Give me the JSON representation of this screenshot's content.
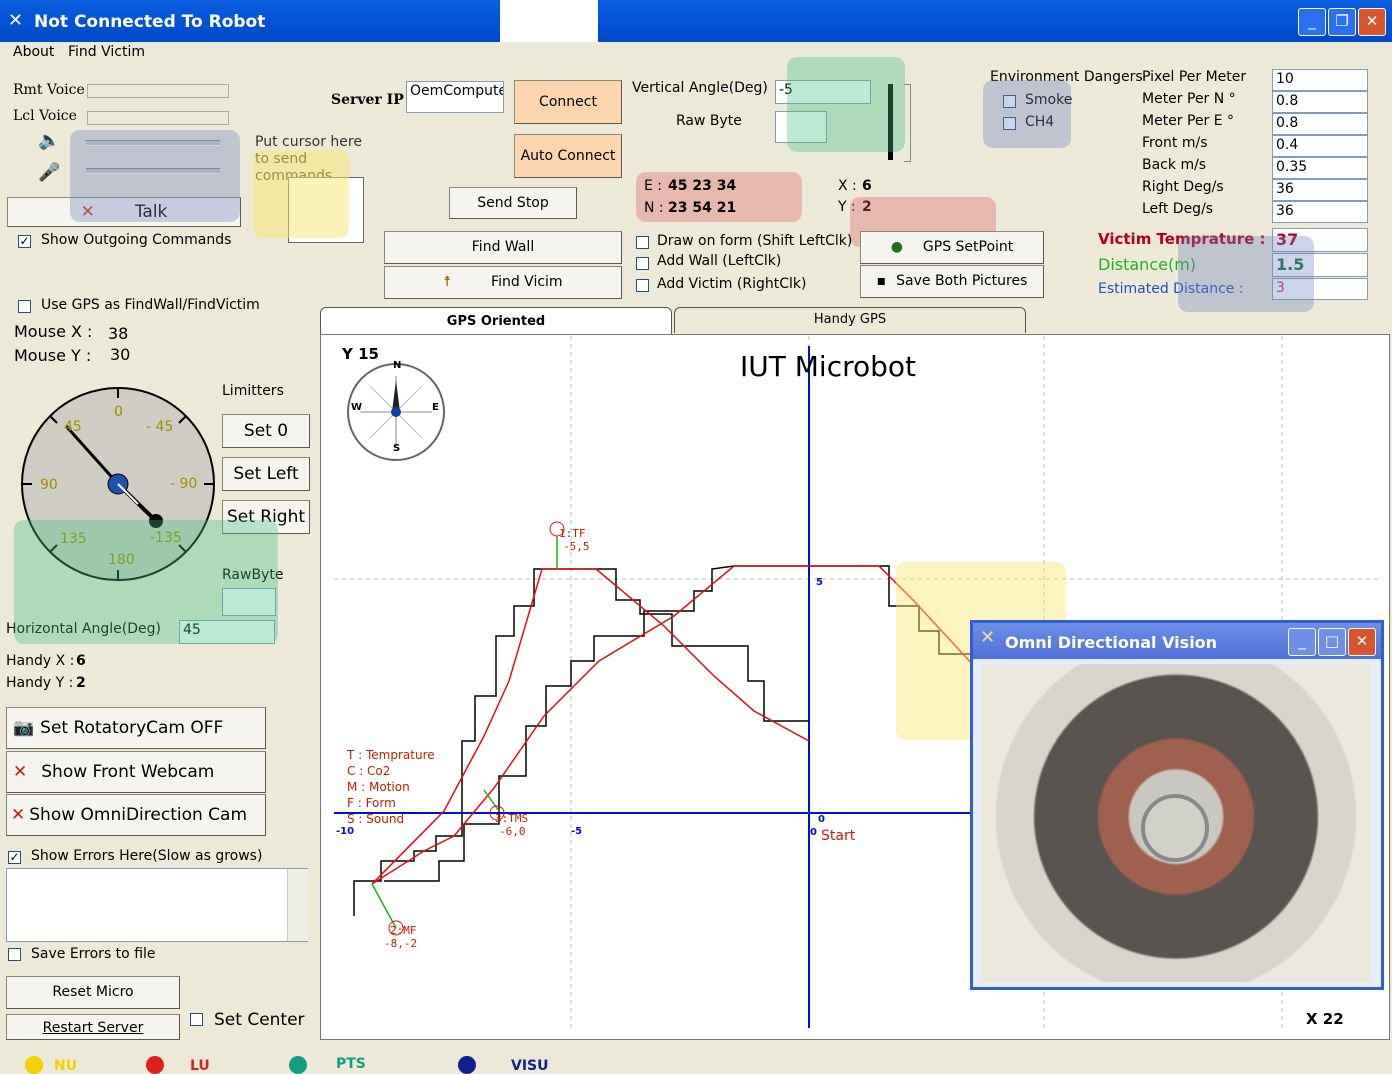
{
  "window": {
    "title": "Not Connected To Robot"
  },
  "menu": {
    "about": "About",
    "find_victim": "Find Victim"
  },
  "voice": {
    "rmt_label": "Rmt Voice",
    "lcl_label": "Lcl Voice",
    "talk_label": "Talk",
    "put_cursor_label": "Put cursor here to send commands"
  },
  "server": {
    "ip_label": "Server IP",
    "ip_value": "OemComputer",
    "connect": "Connect",
    "auto_connect": "Auto Connect",
    "send_stop": "Send Stop",
    "find_wall": "Find Wall",
    "find_victim": "Find Vicim"
  },
  "angles": {
    "vertical_label": "Vertical Angle(Deg)",
    "vertical_value": "-5",
    "raw_byte_label": "Raw Byte",
    "raw_byte_value": ""
  },
  "coords": {
    "e_label": "E :",
    "e_value": "45 23 34",
    "n_label": "N :",
    "n_value": "23 54 21",
    "x_label": "X :",
    "x_value": "6",
    "y_label": "Y :",
    "y_value": "2"
  },
  "draw_options": {
    "draw_on_form": "Draw on form (Shift LeftClk)",
    "add_wall": "Add Wall  (LeftClk)",
    "add_victim": "Add Victim (RightClk)"
  },
  "gps": {
    "setpoint": "GPS SetPoint",
    "save_pictures": "Save Both Pictures",
    "use_gps": "Use GPS as FindWall/FindVictim"
  },
  "environment": {
    "title": "Environment Dangers",
    "smoke": "Smoke",
    "ch4": "CH4"
  },
  "params": [
    {
      "label": "Pixel Per Meter",
      "value": "10"
    },
    {
      "label": "Meter Per N °",
      "value": "0.8"
    },
    {
      "label": "Meter Per E °",
      "value": "0.8"
    },
    {
      "label": "Front m/s",
      "value": "0.4"
    },
    {
      "label": "Back m/s",
      "value": "0.35"
    },
    {
      "label": "Right Deg/s",
      "value": "36"
    },
    {
      "label": "Left  Deg/s",
      "value": "36"
    }
  ],
  "readings": {
    "victim_temp_label": "Victim Temprature :",
    "victim_temp_value": "37",
    "distance_label": "Distance(m)",
    "distance_value": "1.5",
    "est_distance_label": "Estimated Distance  :",
    "est_distance_value": "3"
  },
  "commands": {
    "show_outgoing": "Show Outgoing Commands"
  },
  "mouse": {
    "x_label": "Mouse X :",
    "x_value": "38",
    "y_label": "Mouse Y :",
    "y_value": "30"
  },
  "gauge": {
    "limitters": "Limitters",
    "set0": "Set 0",
    "set_left": "Set Left",
    "set_right": "Set Right",
    "rawbyte_label": "RawByte",
    "horizontal_label": "Horizontal Angle(Deg)",
    "horizontal_value": "45",
    "ticks": [
      "0",
      "- 45",
      "- 90",
      "-135",
      "180",
      "135",
      "90",
      "45"
    ]
  },
  "handy": {
    "x_label": "Handy X :",
    "x_value": "6",
    "y_label": "Handy Y :",
    "y_value": "2"
  },
  "cams": {
    "rotatory": "Set RotatoryCam OFF",
    "front": "Show Front Webcam",
    "omni": "Show OmniDirection Cam"
  },
  "errors": {
    "show_errors": "Show Errors Here(Slow as grows)",
    "save_errors": "Save Errors to file",
    "reset_micro": "Reset Micro",
    "restart_server": "Restart Server",
    "set_center": "Set Center"
  },
  "tabs": {
    "gps_oriented": "GPS Oriented",
    "handy_gps": "Handy GPS"
  },
  "plot": {
    "title": "IUT Microbot",
    "y_label": "Y 15",
    "x_label": "X 22",
    "axis_labels": {
      "x_neg10": "-10",
      "x_neg5": "-5",
      "x_0": "0",
      "y_5": "5",
      "y_0": "0"
    },
    "start": "Start",
    "compass": {
      "n": "N",
      "s": "S",
      "e": "E",
      "w": "W"
    },
    "legend": [
      "T : Temprature",
      "C : Co2",
      "M : Motion",
      "F : Form",
      "S : Sound"
    ],
    "markers": [
      {
        "code": "1:TF",
        "coord": "-5,5"
      },
      {
        "code": "3:TMS",
        "coord": "-6,0"
      },
      {
        "code": "2:MF",
        "coord": "-8,-2"
      }
    ]
  },
  "omni_window": {
    "title": "Omni Directional Vision"
  },
  "status_bar": [
    {
      "label": "NU",
      "color": "#f0d000"
    },
    {
      "label": "LU",
      "color": "#e02020"
    },
    {
      "label": "PTS",
      "color": "#10a080"
    },
    {
      "label": "VISU",
      "color": "#102090"
    }
  ],
  "colors": {
    "titlebar": "#0a5fe0",
    "overlay_blue": "#7080c0",
    "overlay_yellow": "#f8e870",
    "overlay_green": "#40c080",
    "overlay_red": "#e06060"
  }
}
